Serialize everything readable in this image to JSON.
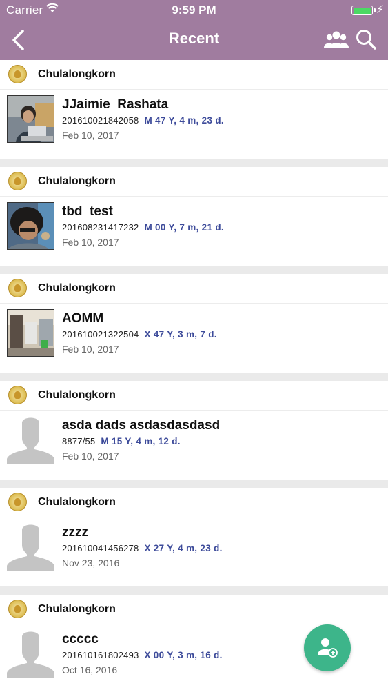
{
  "status_bar": {
    "carrier": "Carrier",
    "time": "9:59 PM",
    "battery_level": 1.0
  },
  "nav": {
    "title": "Recent",
    "icons": [
      "back-chevron-icon",
      "group-icon",
      "search-icon"
    ]
  },
  "colors": {
    "bar": "#a07c9f",
    "age": "#3d4b9a",
    "fab": "#3db58a",
    "divider": "#eaeaea"
  },
  "records": [
    {
      "org": "Chulalongkorn",
      "name": "JJaimie  Rashata",
      "id": "201610021842058",
      "age": "M 47 Y, 4 m, 23 d.",
      "date": "Feb 10, 2017",
      "photo": "photo-1"
    },
    {
      "org": "Chulalongkorn",
      "name": "tbd  test",
      "id": "201608231417232",
      "age": "M 00 Y, 7 m, 21 d.",
      "date": "Feb 10, 2017",
      "photo": "photo-2"
    },
    {
      "org": "Chulalongkorn",
      "name": "AOMM",
      "id": "201610021322504",
      "age": "X 47 Y, 3 m, 7 d.",
      "date": "Feb 10, 2017",
      "photo": "photo-3"
    },
    {
      "org": "Chulalongkorn",
      "name": "asda dads asdasdasdasd",
      "id": "8877/55",
      "age": "M 15 Y, 4 m, 12 d.",
      "date": "Feb 10, 2017",
      "photo": "placeholder"
    },
    {
      "org": "Chulalongkorn",
      "name": "zzzz",
      "id": "201610041456278",
      "age": "X 27 Y, 4 m, 23 d.",
      "date": "Nov 23, 2016",
      "photo": "placeholder"
    },
    {
      "org": "Chulalongkorn",
      "name": "ccccc",
      "id": "201610161802493",
      "age": "X 00 Y, 3 m, 16 d.",
      "date": "Oct 16, 2016",
      "photo": "placeholder"
    }
  ],
  "fab": {
    "icon": "add-person-icon"
  }
}
